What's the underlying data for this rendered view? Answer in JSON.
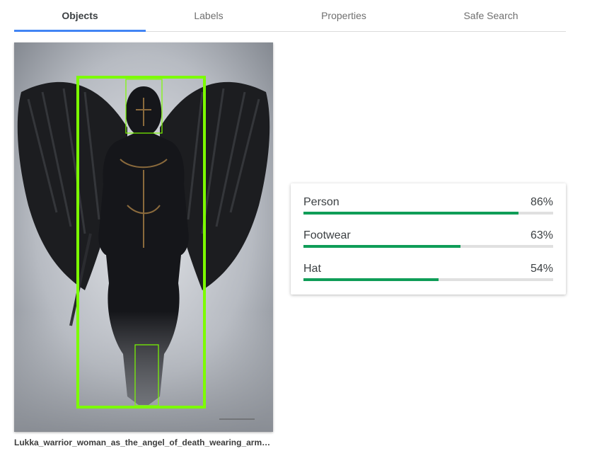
{
  "tabs": [
    {
      "label": "Objects",
      "active": true
    },
    {
      "label": "Labels",
      "active": false
    },
    {
      "label": "Properties",
      "active": false
    },
    {
      "label": "Safe Search",
      "active": false
    }
  ],
  "image": {
    "filename": "Lukka_warrior_woman_as_the_angel_of_death_wearing_armor...",
    "box_color": "#7cfc00"
  },
  "results": [
    {
      "label": "Person",
      "score": 0.86,
      "score_text": "86%"
    },
    {
      "label": "Footwear",
      "score": 0.63,
      "score_text": "63%"
    },
    {
      "label": "Hat",
      "score": 0.54,
      "score_text": "54%"
    }
  ],
  "colors": {
    "tab_indicator": "#4285f4",
    "bar_fill": "#0f9d58",
    "bar_track": "#e0e0e0"
  }
}
